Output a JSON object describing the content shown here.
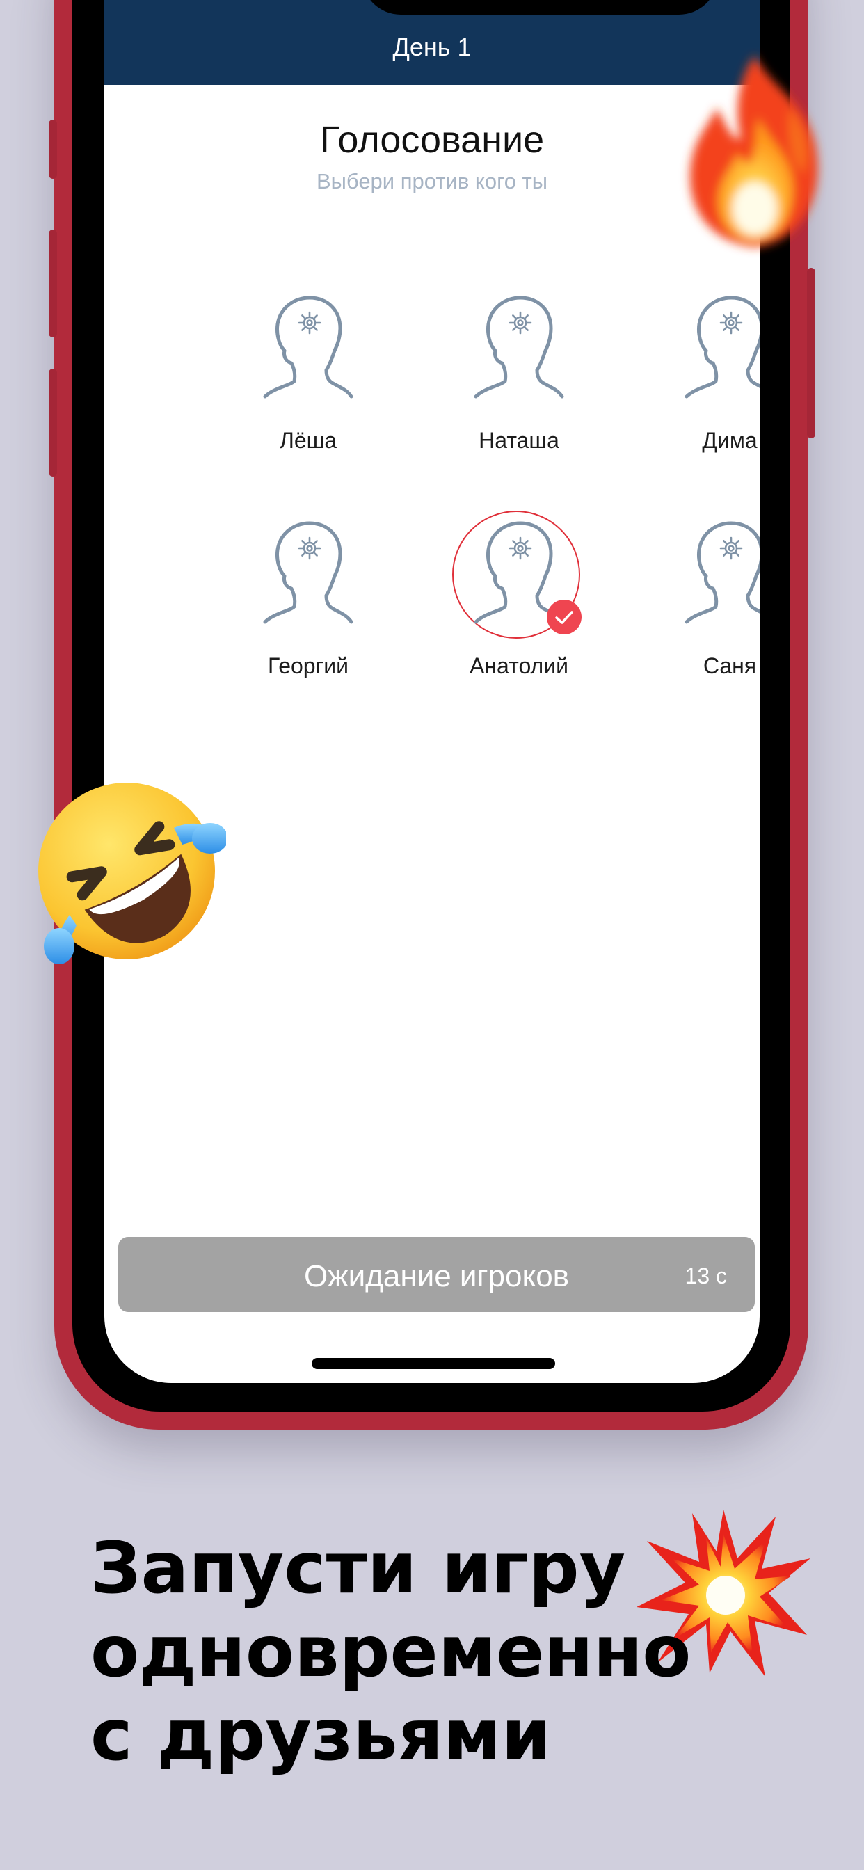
{
  "header": {
    "title": "День 1"
  },
  "screen": {
    "title": "Голосование",
    "subtitle": "Выбери против кого ты"
  },
  "players": [
    {
      "name": "Лёша",
      "selected": false
    },
    {
      "name": "Наташа",
      "selected": false
    },
    {
      "name": "Дима",
      "selected": false
    },
    {
      "name": "Георгий",
      "selected": false
    },
    {
      "name": "Анатолий",
      "selected": true
    },
    {
      "name": "Саня",
      "selected": false
    }
  ],
  "wait_button": {
    "label": "Ожидание игроков",
    "timer": "13 с"
  },
  "caption": {
    "line1": "Запусти игру",
    "line2": "одновременно",
    "line3": "с друзьями"
  },
  "colors": {
    "background": "#d0cfdd",
    "phone_frame": "#b22a3b",
    "header": "#12355a",
    "avatar_stroke": "#7f92a6",
    "selection": "#e0303a",
    "button": "#a3a3a3"
  },
  "icons": {
    "avatar": "head-gear-icon",
    "check": "check-icon",
    "fire": "fire-emoji",
    "laugh": "rofl-emoji",
    "boom": "collision-emoji"
  }
}
